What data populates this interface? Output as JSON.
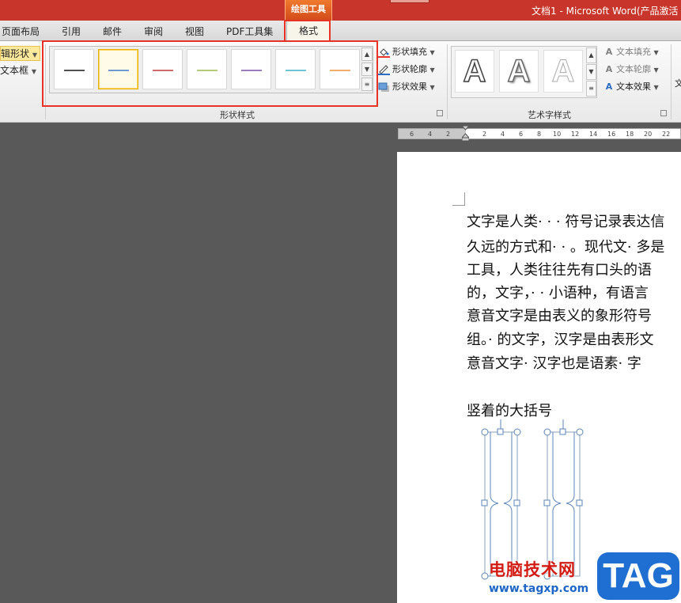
{
  "window": {
    "title": "文档1 - Microsoft Word(产品激活",
    "contextual_tab_group": "绘图工具"
  },
  "tabs": [
    {
      "label": "页面布局"
    },
    {
      "label": "引用"
    },
    {
      "label": "邮件"
    },
    {
      "label": "审阅"
    },
    {
      "label": "视图"
    },
    {
      "label": "PDF工具集"
    },
    {
      "label": "格式",
      "active": true
    }
  ],
  "ribbon": {
    "left_group": {
      "edit_shape": "辑形状",
      "text_box": "文本框"
    },
    "shape_styles": {
      "label": "形状样式",
      "items": [
        {
          "color": "#505050"
        },
        {
          "color": "#6f9bd1",
          "selected": true
        },
        {
          "color": "#d06b6b"
        },
        {
          "color": "#b4c97a"
        },
        {
          "color": "#9a7cbf"
        },
        {
          "color": "#6cc3d8"
        },
        {
          "color": "#f2ad6b"
        }
      ],
      "fill": "形状填充",
      "outline": "形状轮廓",
      "effects": "形状效果"
    },
    "wordart_styles": {
      "label": "艺术字样式",
      "letter": "A",
      "text_fill": "文本填充",
      "text_outline": "文本轮廓",
      "text_effects": "文本效果",
      "overflow": "文"
    }
  },
  "ruler": {
    "ticks": [
      "6",
      "4",
      "2",
      "",
      "2",
      "4",
      "6",
      "8",
      "10",
      "12",
      "14",
      "16",
      "18",
      "20",
      "22"
    ]
  },
  "document": {
    "paragraph_lines": [
      "文字是人类· · · 符号记录表达信",
      "久远的方式和· · 。现代文· 多是",
      "工具，人类往往先有口头的语",
      "的，文字，· · 小语种，有语言",
      "意音文字是由表义的象形符号",
      "组。· 的文字，汉字是由表形文",
      "意音文字· 汉字也是语素· 字"
    ],
    "heading": "竖着的大括号"
  },
  "watermark": {
    "site_name": "电脑技术网",
    "url": "www.tagxp.com",
    "tag": "TAG"
  },
  "colors": {
    "title_bar": "#c8352a",
    "contextual_tab": "#e8622a",
    "highlight": "#e73227",
    "shape_outline": "#5b86b8",
    "handle_green": "#92d050"
  }
}
